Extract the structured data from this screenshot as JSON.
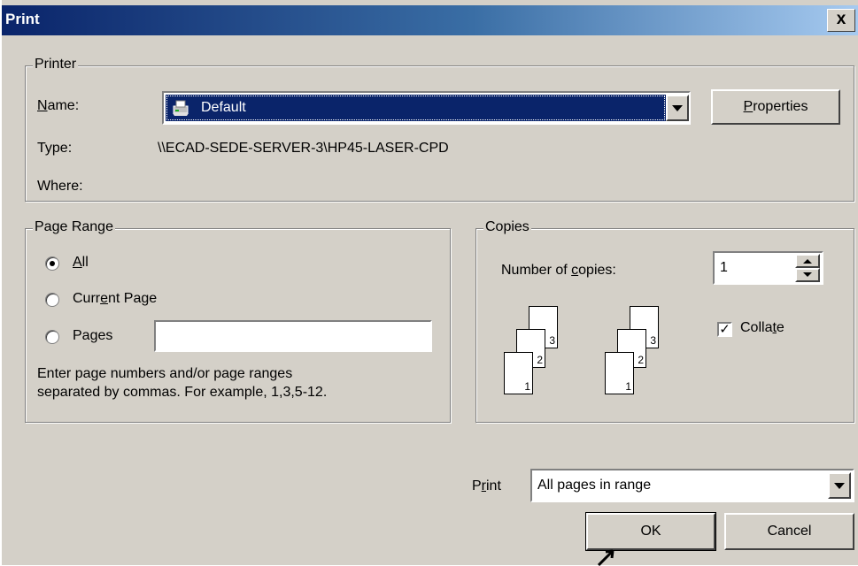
{
  "dialog": {
    "title": "Print",
    "close_glyph": "x"
  },
  "printer": {
    "legend": "Printer",
    "name_label": "Name:",
    "name_value": "Default",
    "type_label": "Type:",
    "type_value": "\\\\ECAD-SEDE-SERVER-3\\HP45-LASER-CPD",
    "where_label": "Where:",
    "properties_label": "Properties",
    "printer_icon": "printer-icon"
  },
  "page_range": {
    "legend": "Page Range",
    "options": [
      {
        "label": "All",
        "selected": true
      },
      {
        "label": "Current Page",
        "selected": false
      },
      {
        "label": "Pages",
        "selected": false
      }
    ],
    "pages_value": "",
    "hint_line1": "Enter page numbers and/or page ranges",
    "hint_line2": "separated by commas.  For example, 1,3,5-12."
  },
  "copies": {
    "legend": "Copies",
    "number_label": "Number of copies:",
    "number_value": "1",
    "collate_label": "Collate",
    "collate_checked": true,
    "page_numbers": [
      "1",
      "2",
      "3"
    ]
  },
  "print_what": {
    "label": "Print",
    "value": "All pages in range"
  },
  "buttons": {
    "ok": "OK",
    "cancel": "Cancel"
  },
  "colors": {
    "title_start": "#0a246a",
    "title_end": "#a6caf0",
    "face": "#d4d0c8",
    "selection": "#0a246a"
  }
}
